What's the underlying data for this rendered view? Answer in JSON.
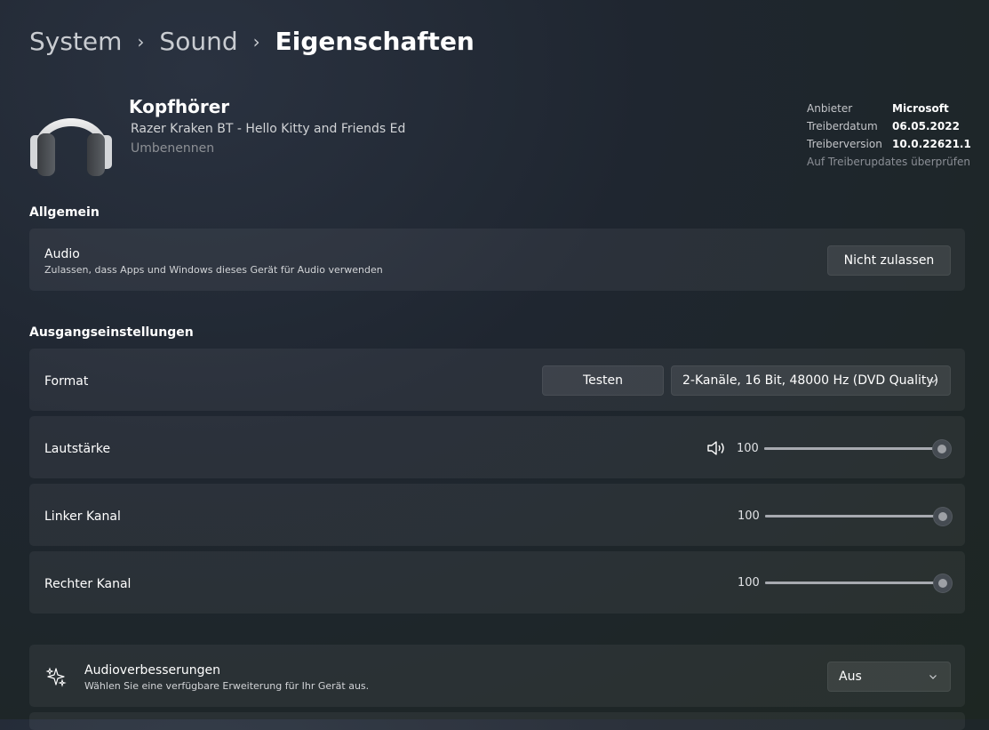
{
  "breadcrumb": {
    "system": "System",
    "sound": "Sound",
    "current": "Eigenschaften",
    "separator": "›"
  },
  "device": {
    "name": "Kopfhörer",
    "model": "Razer Kraken BT - Hello Kitty and Friends Ed",
    "rename": "Umbenennen",
    "icon": "headphones-icon"
  },
  "driver": {
    "provider_label": "Anbieter",
    "provider": "Microsoft",
    "date_label": "Treiberdatum",
    "date": "06.05.2022",
    "version_label": "Treiberversion",
    "version": "10.0.22621.1",
    "update_link": "Auf Treiberupdates überprüfen"
  },
  "general": {
    "title": "Allgemein",
    "audio": {
      "title": "Audio",
      "subtitle": "Zulassen, dass Apps und Windows dieses Gerät für Audio verwenden",
      "button": "Nicht zulassen"
    }
  },
  "output": {
    "title": "Ausgangseinstellungen",
    "format": {
      "label": "Format",
      "test_button": "Testen",
      "selected": "2-Kanäle, 16 Bit, 48000 Hz (DVD Quality)"
    },
    "volume": {
      "label": "Lautstärke",
      "value": "100",
      "level": 1.0,
      "icon": "speaker-icon"
    },
    "left": {
      "label": "Linker Kanal",
      "value": "100",
      "level": 1.0
    },
    "right": {
      "label": "Rechter Kanal",
      "value": "100",
      "level": 1.0
    }
  },
  "enhancements": {
    "title": "Audioverbesserungen",
    "subtitle": "Wählen Sie eine verfügbare Erweiterung für Ihr Gerät aus.",
    "selected": "Aus",
    "icon": "sparkle-icon"
  }
}
